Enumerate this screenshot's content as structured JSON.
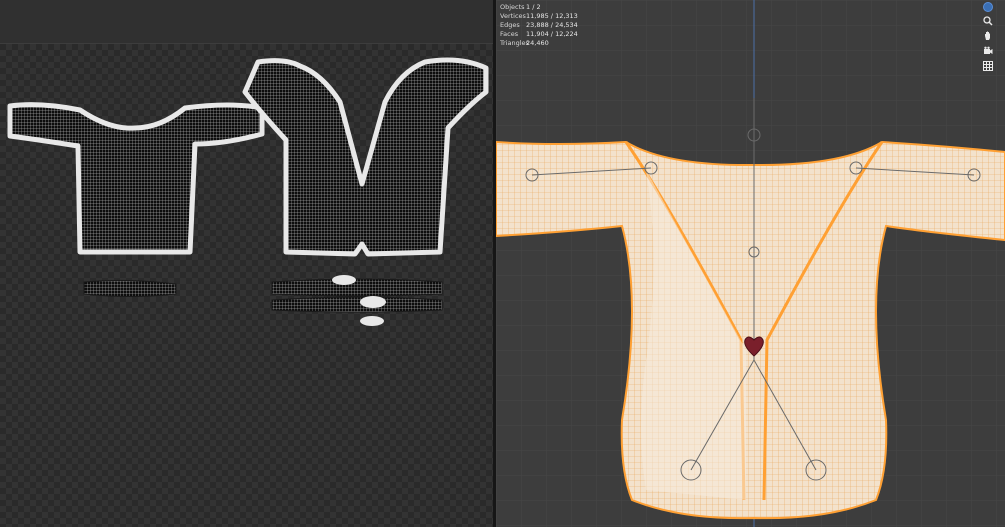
{
  "viewport": {
    "stats": [
      {
        "label": "Objects",
        "value": "1 / 2"
      },
      {
        "label": "Vertices",
        "value": "11,985 / 12,313"
      },
      {
        "label": "Edges",
        "value": "23,888 / 24,534"
      },
      {
        "label": "Faces",
        "value": "11,904 / 12,224"
      },
      {
        "label": "Triangles",
        "value": "24,460"
      }
    ],
    "nav_icons": [
      "axis-gizmo-icon",
      "zoom-icon",
      "pan-hand-icon",
      "camera-icon",
      "grid-icon"
    ]
  },
  "colors": {
    "selection_outline": "#ffa033",
    "mesh_fill": "#f3e2cc",
    "heart": "#7a1f2b",
    "uv_island_border": "#e8e8e8"
  }
}
